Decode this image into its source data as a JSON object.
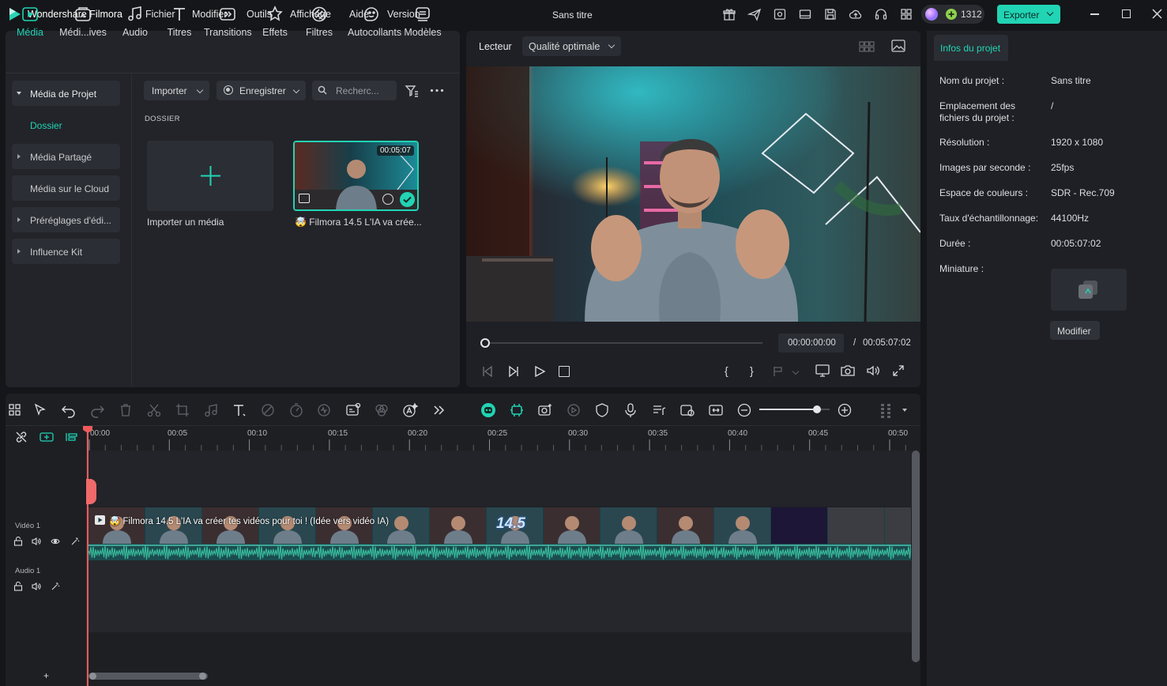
{
  "app": {
    "name": "Wondershare Filmora",
    "document_title": "Sans titre",
    "credits": "1312",
    "export_label": "Exporter"
  },
  "menu": [
    "Fichier",
    "Modifier",
    "Outils",
    "Affichage",
    "Aide",
    "Version"
  ],
  "toolbar_tabs": [
    {
      "label": "Média",
      "icon": "media-icon",
      "active": true
    },
    {
      "label": "Médi...ives",
      "icon": "stock-media-icon"
    },
    {
      "label": "Audio",
      "icon": "music-note-icon"
    },
    {
      "label": "Titres",
      "icon": "text-t-icon"
    },
    {
      "label": "Transitions",
      "icon": "transition-icon"
    },
    {
      "label": "Effets",
      "icon": "effects-icon"
    },
    {
      "label": "Filtres",
      "icon": "filter-icon"
    },
    {
      "label": "Autocollants",
      "icon": "sticker-icon"
    },
    {
      "label": "Modèles",
      "icon": "templates-icon"
    }
  ],
  "sidebar": {
    "items": [
      {
        "label": "Média de Projet",
        "expanded": true
      },
      {
        "label": "Dossier",
        "selected": true
      },
      {
        "label": "Média Partagé"
      },
      {
        "label": "Média sur le Cloud"
      },
      {
        "label": "Préréglages d'édi..."
      },
      {
        "label": "Influence Kit"
      }
    ]
  },
  "media_toolbar": {
    "import_label": "Importer",
    "record_label": "Enregistrer",
    "search_placeholder": "Recherc..."
  },
  "media_section_title": "DOSSIER",
  "media_items": [
    {
      "label": "Importer un média",
      "type": "import"
    },
    {
      "label": "Filmora 14.5  L'IA va crée...",
      "duration": "00:05:07",
      "emoji": "🤯"
    }
  ],
  "player": {
    "tab_label": "Lecteur",
    "quality_label": "Qualité optimale",
    "current_time": "00:00:00:00",
    "separator": "/",
    "total_time": "00:05:07:02",
    "progress": 0,
    "mark_in": "{",
    "mark_out": "}"
  },
  "project_info": {
    "tab_label": "Infos du projet",
    "rows": [
      {
        "label": "Nom du projet :",
        "value": "Sans titre"
      },
      {
        "label": "Emplacement des fichiers du projet :",
        "value": "/"
      },
      {
        "label": "Résolution :",
        "value": "1920 x 1080"
      },
      {
        "label": "Images par seconde :",
        "value": "25fps"
      },
      {
        "label": "Espace de couleurs :",
        "value": "SDR - Rec.709"
      },
      {
        "label": "Taux d'échantillonnage:",
        "value": "44100Hz"
      },
      {
        "label": "Durée :",
        "value": "00:05:07:02"
      },
      {
        "label": "Miniature :",
        "value": ""
      }
    ],
    "modify_label": "Modifier"
  },
  "timeline": {
    "ruler": [
      "00:00",
      "00:05",
      "00:10",
      "00:15",
      "00:20",
      "00:25",
      "00:30",
      "00:35",
      "00:40",
      "00:45",
      "00:50"
    ],
    "video_track_label": "Vidéo 1",
    "audio_track_label": "Audio 1",
    "clip_title": "Filmora 14.5  L'IA va créer tes vidéos pour toi ! (Idée vers vidéo IA)",
    "clip_overlay_text": "14.5",
    "zoom_level": 0.82,
    "add_track": "+"
  },
  "colors": {
    "accent": "#21d4b4",
    "export_button": "#21d4b4",
    "playhead": "#f05a5a",
    "audio_wave": "#38b99a"
  }
}
